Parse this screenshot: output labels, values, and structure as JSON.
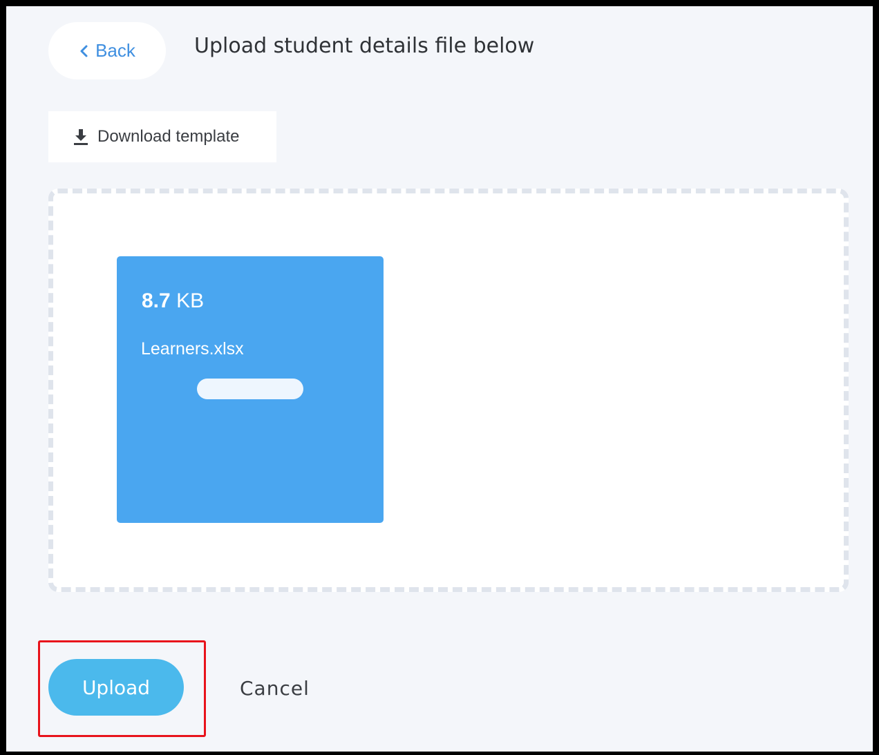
{
  "header": {
    "back_label": "Back",
    "back_icon": "chevron-left-icon",
    "title": "Upload student details file below"
  },
  "download": {
    "label": "Download template",
    "icon": "download-icon"
  },
  "dropzone": {
    "file": {
      "size_value": "8.7",
      "size_unit": "KB",
      "name": "Learners.xlsx",
      "progress": 1.0
    }
  },
  "actions": {
    "upload_label": "Upload",
    "cancel_label": "Cancel"
  },
  "colors": {
    "accent": "#3f8fe0",
    "file_card": "#4aa6f0",
    "upload_button": "#4bb9ec",
    "highlight": "#e8131b"
  }
}
